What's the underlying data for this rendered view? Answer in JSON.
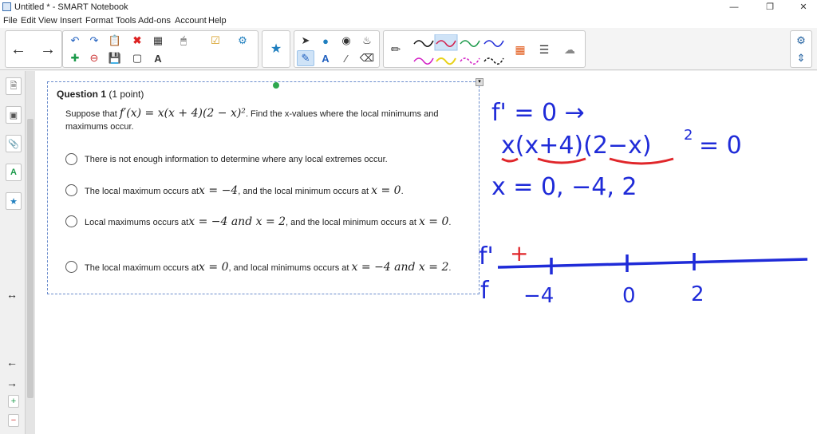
{
  "window": {
    "title": "Untitled * - SMART Notebook"
  },
  "menu": [
    "File",
    "Edit",
    "View",
    "Insert",
    "Format",
    "Tools",
    "Add-ons",
    "Account",
    "Help"
  ],
  "question": {
    "title": "Question 1",
    "points": "(1 point)",
    "prompt_pre": "Suppose that ",
    "prompt_math": "f′(x) = x(x + 4)(2 − x)²",
    "prompt_post": ". Find the x-values where the local minimums and maximums occur.",
    "options": [
      {
        "pre": "There is not enough information to determine where any local extremes occur.",
        "math1": "",
        "mid": "",
        "math2": "",
        "post": ""
      },
      {
        "pre": "The local maximum occurs at",
        "math1": "x = −4",
        "mid": ", and the local minimum occurs at ",
        "math2": "x = 0",
        "post": "."
      },
      {
        "pre": "Local maximums occurs at",
        "math1": "x = −4 and x = 2",
        "mid": ", and the local minimum occurs at ",
        "math2": "x = 0",
        "post": "."
      },
      {
        "pre": "The local maximum occurs at",
        "math1": "x = 0",
        "mid": ", and local minimums occurs at ",
        "math2": "x = −4 and x = 2",
        "post": "."
      }
    ]
  },
  "handwriting": {
    "line1": "f' = 0 →",
    "line2a": "x(x+4)(2−x)",
    "line2b": "2",
    "line2c": "= 0",
    "line3": "x = 0, −4, 2",
    "axis_f1": "f'",
    "axis_f": "f",
    "plus_sign": "+",
    "ticks": [
      "−4",
      "0",
      "2"
    ]
  },
  "colors": {
    "ink_blue": "#1f2bd8",
    "ink_red": "#e0262a",
    "selected_pen": "#cfe3f7"
  }
}
